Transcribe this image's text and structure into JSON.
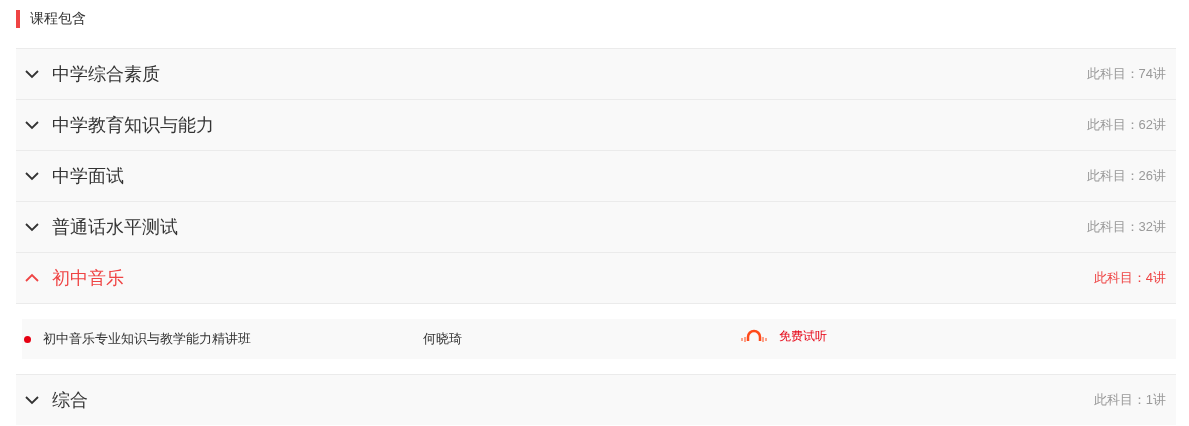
{
  "section_title": "课程包含",
  "subjects": [
    {
      "name": "中学综合素质",
      "count": "此科目：74讲",
      "expanded": false
    },
    {
      "name": "中学教育知识与能力",
      "count": "此科目：62讲",
      "expanded": false
    },
    {
      "name": "中学面试",
      "count": "此科目：26讲",
      "expanded": false
    },
    {
      "name": "普通话水平测试",
      "count": "此科目：32讲",
      "expanded": false
    },
    {
      "name": "初中音乐",
      "count": "此科目：4讲",
      "expanded": true,
      "lessons": [
        {
          "title": "初中音乐专业知识与教学能力精讲班",
          "teacher": "何晓琦",
          "trial": "免费试听"
        }
      ]
    },
    {
      "name": "综合",
      "count": "此科目：1讲",
      "expanded": false
    }
  ]
}
